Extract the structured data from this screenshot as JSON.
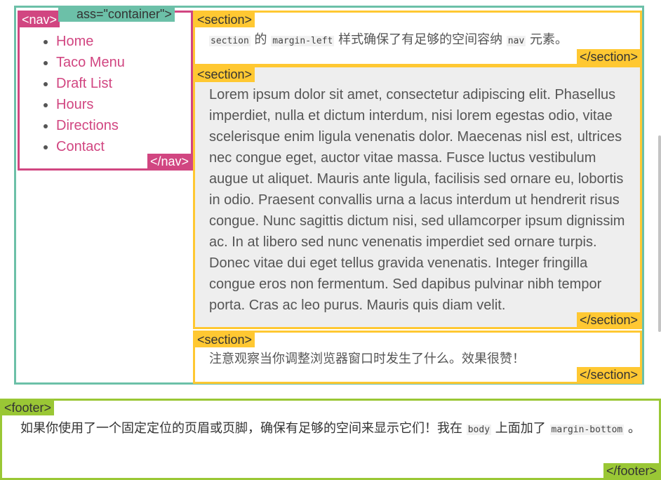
{
  "container": {
    "open_tag": "ass=\"container\">"
  },
  "nav": {
    "open_tag": "<nav>",
    "close_tag": "</nav>",
    "items": [
      "Home",
      "Taco Menu",
      "Draft List",
      "Hours",
      "Directions",
      "Contact"
    ]
  },
  "section1": {
    "open_tag": "<section>",
    "close_tag": "</section>",
    "code1": "section",
    "t1": " 的 ",
    "code2": "margin-left",
    "t2": " 样式确保了有足够的空间容纳 ",
    "code3": "nav",
    "t3": " 元素。"
  },
  "section2": {
    "open_tag": "<section>",
    "close_tag": "</section>",
    "text": "Lorem ipsum dolor sit amet, consectetur adipiscing elit. Phasellus imperdiet, nulla et dictum interdum, nisi lorem egestas odio, vitae scelerisque enim ligula venenatis dolor. Maecenas nisl est, ultrices nec congue eget, auctor vitae massa. Fusce luctus vestibulum augue ut aliquet. Mauris ante ligula, facilisis sed ornare eu, lobortis in odio. Praesent convallis urna a lacus interdum ut hendrerit risus congue. Nunc sagittis dictum nisi, sed ullamcorper ipsum dignissim ac. In at libero sed nunc venenatis imperdiet sed ornare turpis. Donec vitae dui eget tellus gravida venenatis. Integer fringilla congue eros non fermentum. Sed dapibus pulvinar nibh tempor porta. Cras ac leo purus. Mauris quis diam velit."
  },
  "section3": {
    "open_tag": "<section>",
    "close_tag": "</section>",
    "text": "注意观察当你调整浏览器窗口时发生了什么。效果很赞！"
  },
  "footer": {
    "open_tag": "<footer>",
    "close_tag": "</footer>",
    "t1": "如果你使用了一个固定定位的页眉或页脚，确保有足够的空间来显示它们！我在 ",
    "code1": "body",
    "t2": " 上面加了 ",
    "code2": "margin-bottom",
    "t3": " 。"
  },
  "colors": {
    "container": "#6cc0a8",
    "nav": "#d14681",
    "section": "#ffc832",
    "footer": "#9ac735"
  }
}
